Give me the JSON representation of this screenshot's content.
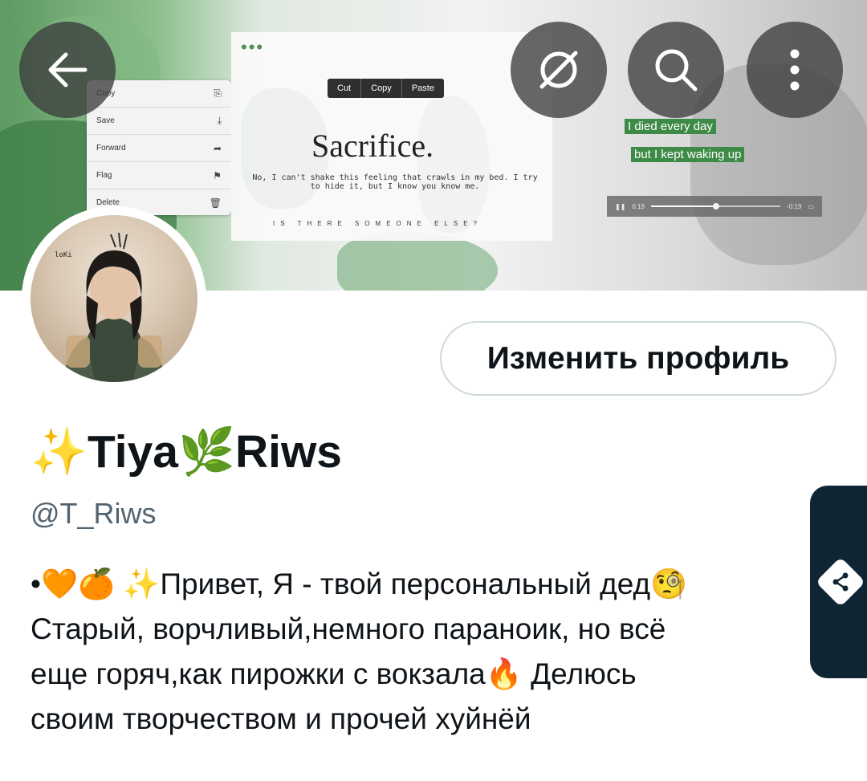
{
  "banner": {
    "context_menu": [
      "Copy",
      "Save",
      "Forward",
      "Flag",
      "Delete"
    ],
    "context_menu_glyphs": [
      "⎘",
      "⤓",
      "➦",
      "⚑",
      "🗑"
    ],
    "edit_bar": [
      "Cut",
      "Copy",
      "Paste"
    ],
    "headline": "Sacrifice.",
    "subtitle": "No, I can't shake this feeling that crawls in my bed. I try to hide it, but I know you know me.",
    "tagline": "IS THERE SOMEONE ELSE?",
    "lyric_line_1": "I died every day",
    "lyric_line_2": "but I kept waking up",
    "player_time_elapsed": "0:19",
    "player_time_remaining": "-0:19",
    "player_progress": 0.5
  },
  "nav": {
    "back_icon": "arrow-left-icon",
    "nolink_icon": "link-off-icon",
    "search_icon": "search-icon",
    "more_icon": "more-vertical-icon"
  },
  "profile": {
    "edit_button": "Изменить профиль",
    "display_name": "✨Tiya🌿Riws",
    "handle": "@T_Riws",
    "bio": "•🧡🍊 ✨Привет, Я - твой персональный дед🧐\nСтарый, ворчливый,немного параноик, но всё\nеще горяч,как пирожки с вокзала🔥 Делюсь\nсвоим творчеством и прочей хуйнёй"
  },
  "colors": {
    "text_primary": "#0f1419",
    "text_secondary": "#536471",
    "button_border": "#cfd9de",
    "side_tab": "#0f2533",
    "banner_green": "#3e8a47"
  }
}
